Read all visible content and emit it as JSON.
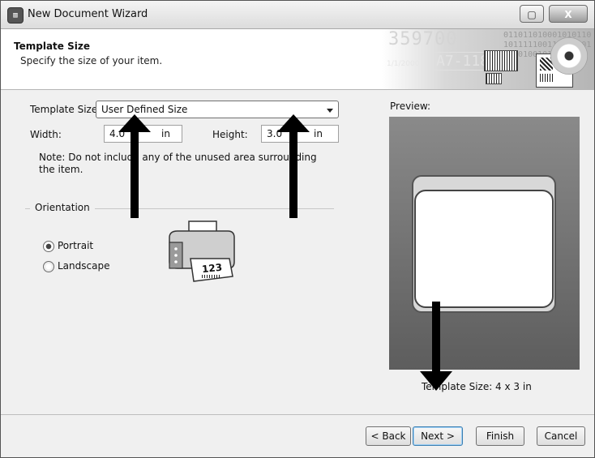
{
  "window": {
    "title": "New Document Wizard",
    "close_glyph": "X"
  },
  "header": {
    "title": "Template Size",
    "subtitle": "Specify the size of your item.",
    "banner_big": "3597001",
    "banner_mid": "A7-118",
    "banner_small": "1/1/2000",
    "banner_binary": "01101101000101011010111110011010110101101001010111101"
  },
  "form": {
    "template_size_label": "Template Size:",
    "template_size_value": "User Defined Size",
    "width_label": "Width:",
    "width_value": "4.0",
    "width_unit": "in",
    "height_label": "Height:",
    "height_value": "3.0",
    "height_unit": "in",
    "note": "Note: Do not include any of the unused area surrounding the item."
  },
  "orientation": {
    "group_label": "Orientation",
    "portrait_label": "Portrait",
    "landscape_label": "Landscape",
    "selected": "Portrait",
    "printer_label_text": "123"
  },
  "preview": {
    "caption": "Preview:",
    "template_size_text": "Template Size:  4 x 3 in"
  },
  "buttons": {
    "back": "< Back",
    "next": "Next >",
    "finish": "Finish",
    "cancel": "Cancel"
  }
}
